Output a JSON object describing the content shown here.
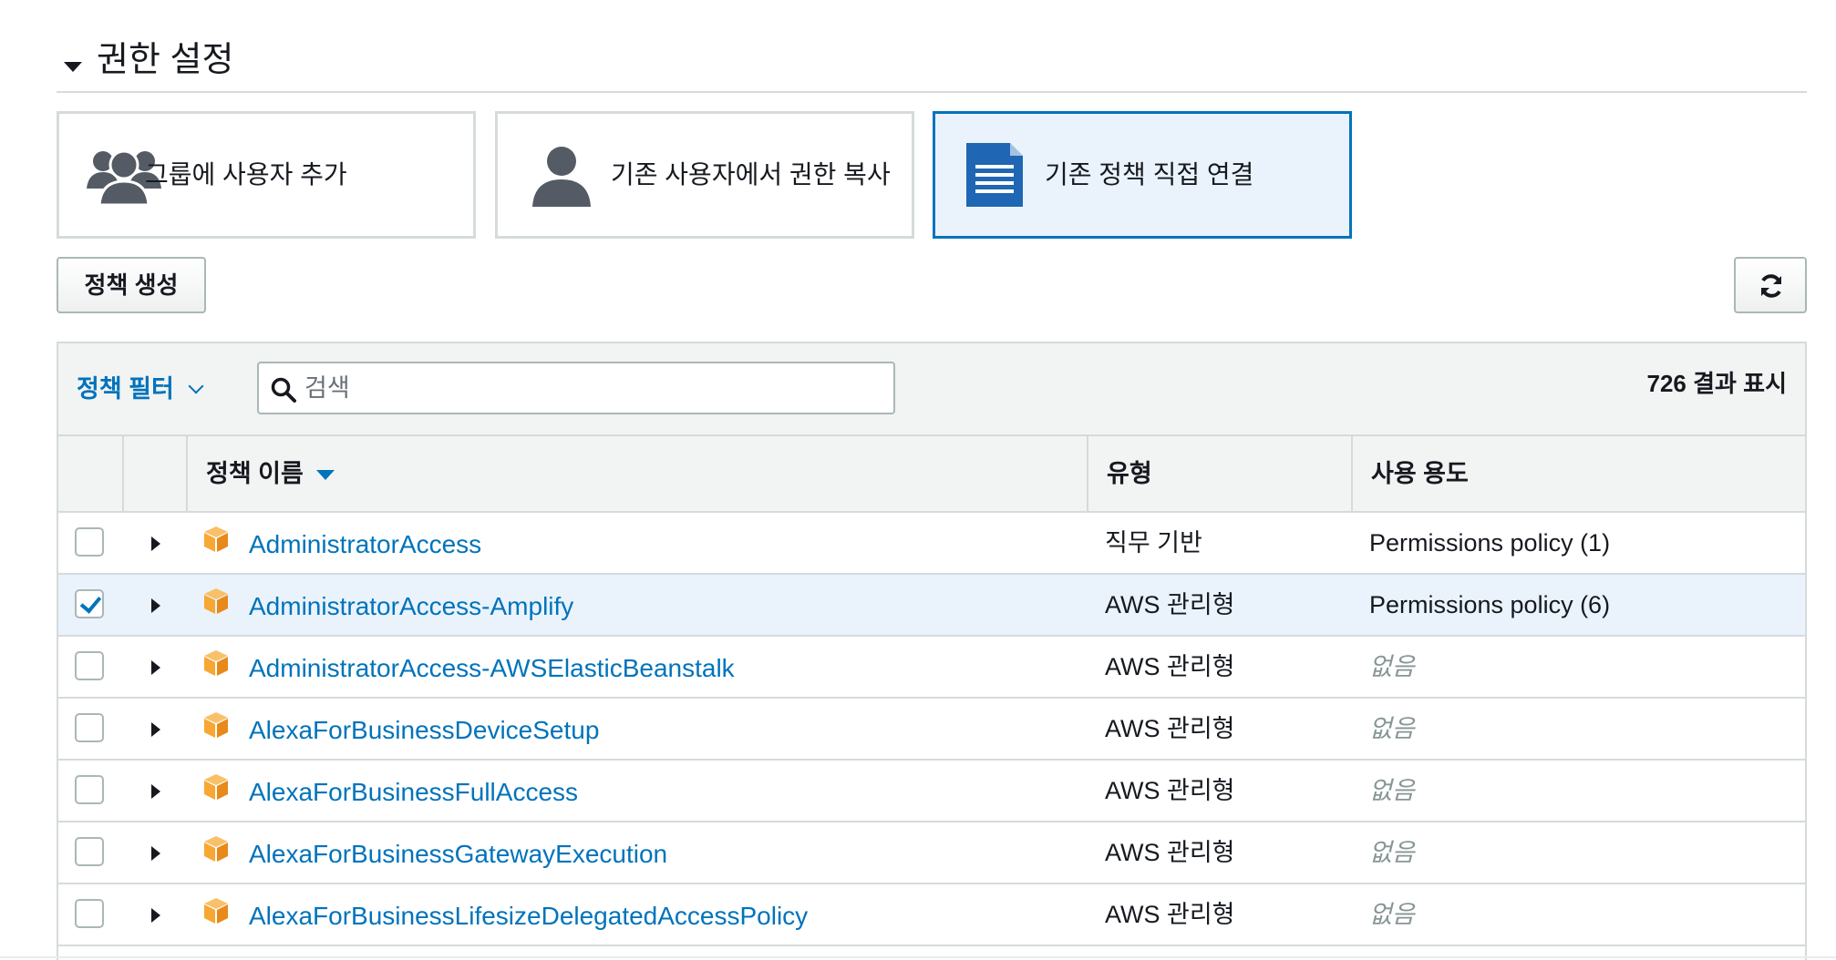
{
  "section": {
    "title": "권한 설정"
  },
  "tiles": [
    {
      "label": "그룹에 사용자 추가",
      "icon": "users-group-icon",
      "selected": false
    },
    {
      "label": "기존 사용자에서 권한 복사",
      "icon": "user-icon",
      "selected": false
    },
    {
      "label": "기존 정책 직접 연결",
      "icon": "document-icon",
      "selected": true
    }
  ],
  "toolbar": {
    "create_policy_label": "정책 생성",
    "refresh_icon": "refresh-icon"
  },
  "filter": {
    "label": "정책 필터",
    "search_placeholder": "검색",
    "result_count": "726 결과 표시"
  },
  "table": {
    "headers": {
      "name": "정책 이름",
      "type": "유형",
      "usage": "사용 용도"
    },
    "rows": [
      {
        "name": "AdministratorAccess",
        "type": "직무 기반",
        "usage": "Permissions policy (1)",
        "checked": false
      },
      {
        "name": "AdministratorAccess-Amplify",
        "type": "AWS 관리형",
        "usage": "Permissions policy (6)",
        "checked": true
      },
      {
        "name": "AdministratorAccess-AWSElasticBeanstalk",
        "type": "AWS 관리형",
        "usage": "없음",
        "checked": false
      },
      {
        "name": "AlexaForBusinessDeviceSetup",
        "type": "AWS 관리형",
        "usage": "없음",
        "checked": false
      },
      {
        "name": "AlexaForBusinessFullAccess",
        "type": "AWS 관리형",
        "usage": "없음",
        "checked": false
      },
      {
        "name": "AlexaForBusinessGatewayExecution",
        "type": "AWS 관리형",
        "usage": "없음",
        "checked": false
      },
      {
        "name": "AlexaForBusinessLifesizeDelegatedAccessPolicy",
        "type": "AWS 관리형",
        "usage": "없음",
        "checked": false
      }
    ]
  },
  "colors": {
    "link": "#0073bb",
    "selected_bg": "#eaf3fc",
    "policy_icon": "#f7a733",
    "tile_icon": "#545b64"
  }
}
